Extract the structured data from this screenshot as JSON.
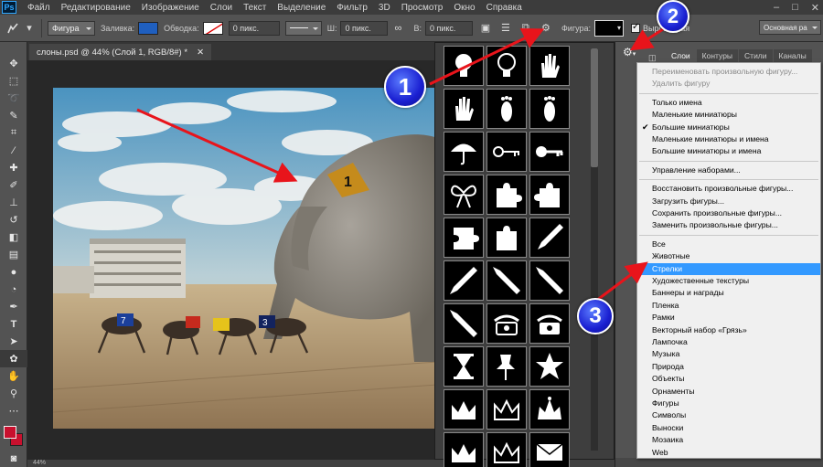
{
  "app": {
    "logo_text": "Ps"
  },
  "menubar": {
    "items": [
      "Файл",
      "Редактирование",
      "Изображение",
      "Слои",
      "Текст",
      "Выделение",
      "Фильтр",
      "3D",
      "Просмотр",
      "Окно",
      "Справка"
    ]
  },
  "options_bar": {
    "mode_value": "Фигура",
    "fill_label": "Заливка:",
    "fill_color": "#1f5fbf",
    "stroke_label": "Обводка:",
    "stroke_width_value": "0 пикс.",
    "width_label": "Ш:",
    "width_value": "0 пикс.",
    "height_label": "В:",
    "height_value": "0 пикс.",
    "shape_label": "Фигура:",
    "align_edges_label": "Выров. края",
    "workspace_value": "Основная рабочая"
  },
  "document": {
    "tab_title": "слоны.psd @ 44% (Слой 1, RGB/8#) *",
    "status_text": "44%"
  },
  "shape_picker": {
    "shapes": [
      "lightbulb-1",
      "lightbulb-2",
      "hand-1",
      "hand-2",
      "footprint-left",
      "footprint-right",
      "umbrella",
      "key-1",
      "key-2",
      "bow",
      "puzzle-1",
      "puzzle-2",
      "puzzle-3",
      "puzzle-4",
      "pencil-1",
      "pencil-2",
      "pencil-3",
      "pencil-4",
      "pencil-5",
      "phone-1",
      "phone-2",
      "hourglass",
      "pushpin",
      "sheriff-star",
      "crown-1",
      "crown-2",
      "crown-3",
      "crown-4",
      "crown-5",
      "envelope"
    ]
  },
  "panels": {
    "tabs": [
      "Слои",
      "Контуры",
      "Стили",
      "Каналы"
    ]
  },
  "context_menu": {
    "items": [
      {
        "label": "Переименовать произвольную фигуру...",
        "disabled": true
      },
      {
        "label": "Удалить фигуру",
        "disabled": true
      },
      {
        "label": "Только имена"
      },
      {
        "label": "Маленькие миниатюры"
      },
      {
        "label": "Большие миниатюры",
        "checked": true
      },
      {
        "label": "Маленькие миниатюры и имена"
      },
      {
        "label": "Большие миниатюры и имена"
      },
      {
        "label": "Управление наборами..."
      },
      {
        "label": "Восстановить произвольные фигуры..."
      },
      {
        "label": "Загрузить фигуры..."
      },
      {
        "label": "Сохранить произвольные фигуры..."
      },
      {
        "label": "Заменить произвольные фигуры..."
      },
      {
        "label": "Все"
      },
      {
        "label": "Животные"
      },
      {
        "label": "Стрелки",
        "highlighted": true
      },
      {
        "label": "Художественные текстуры"
      },
      {
        "label": "Баннеры и награды"
      },
      {
        "label": "Пленка"
      },
      {
        "label": "Рамки"
      },
      {
        "label": "Векторный набор «Грязь»"
      },
      {
        "label": "Лампочка"
      },
      {
        "label": "Музыка"
      },
      {
        "label": "Природа"
      },
      {
        "label": "Объекты"
      },
      {
        "label": "Орнаменты"
      },
      {
        "label": "Фигуры"
      },
      {
        "label": "Символы"
      },
      {
        "label": "Выноски"
      },
      {
        "label": "Мозаика"
      },
      {
        "label": "Web"
      }
    ]
  },
  "annotations": {
    "badge_1": "1",
    "badge_2": "2",
    "badge_3": "3",
    "arrow_color": "#e8141b"
  },
  "colors": {
    "foreground": "#c8102e",
    "highlight": "#3399ff"
  }
}
